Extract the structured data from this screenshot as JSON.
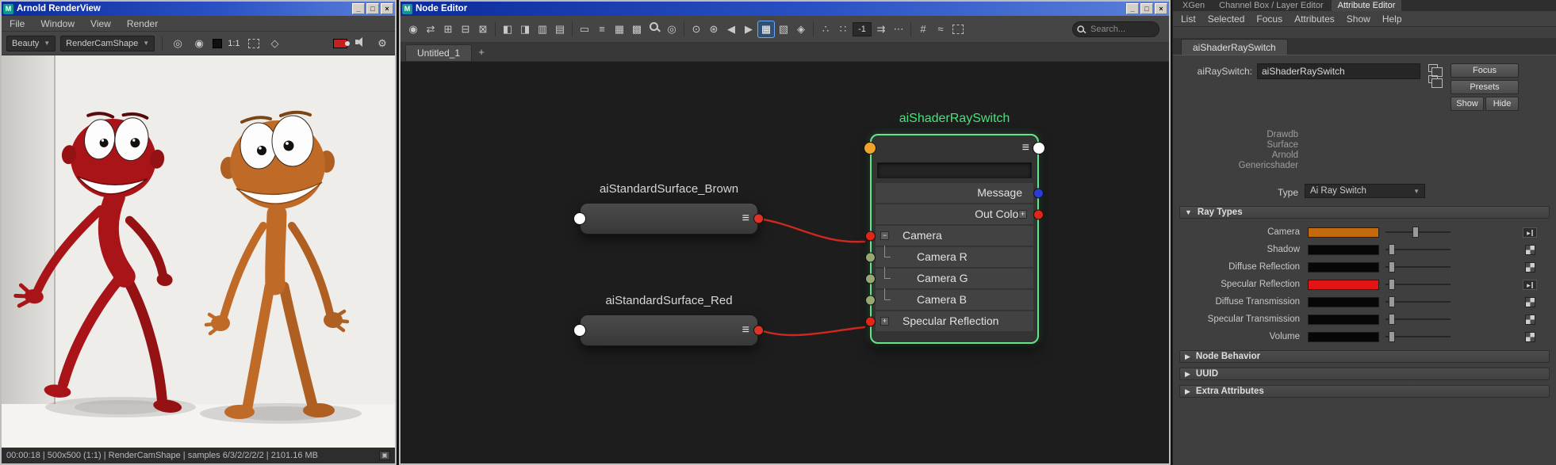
{
  "colors": {
    "wire": "#d0281e",
    "accent_green": "#55e07e"
  },
  "window_controls": [
    {
      "name": "minimize-button",
      "glyph": "_"
    },
    {
      "name": "maximize-button",
      "glyph": "□"
    },
    {
      "name": "close-button",
      "glyph": "×"
    }
  ],
  "maya_icon_text": "M",
  "render_view": {
    "window_title": "Arnold RenderView",
    "menus": [
      "File",
      "Window",
      "View",
      "Render"
    ],
    "toolbar": {
      "aov": "Beauty",
      "camera": "RenderCamShape",
      "icons": [
        {
          "n": "snapshot-target-icon",
          "g": "◎"
        },
        {
          "n": "rgb-channels-icon",
          "g": "◉"
        },
        {
          "n": "background-swatch",
          "t": "swatch-dark"
        },
        {
          "n": "zoom-ratio-label",
          "g": "1:1",
          "t": "label"
        },
        {
          "n": "crop-region-icon",
          "t": "dash"
        },
        {
          "n": "isolate-selected-icon",
          "g": "◇"
        },
        {
          "n": "spacer",
          "t": "spacer"
        },
        {
          "n": "foreground-color-swatch",
          "t": "swatch-red"
        },
        {
          "n": "audio-icon",
          "t": "speaker"
        },
        {
          "n": "render-settings-gear-icon",
          "g": "⚙"
        }
      ]
    },
    "status": "00:00:18 | 500x500 (1:1) | RenderCamShape  | samples 6/3/2/2/2/2 | 2101.16 MB"
  },
  "node_editor": {
    "window_title": "Node Editor",
    "tab": "Untitled_1",
    "new_tab": "+",
    "precision": "-1",
    "search_placeholder": "Search...",
    "toolbar_icons": [
      {
        "n": "pin-panel-icon",
        "g": "◉"
      },
      {
        "n": "sync-graph-icon",
        "g": "⇄"
      },
      {
        "n": "add-to-graph-icon",
        "g": "⊞"
      },
      {
        "n": "remove-from-graph-icon",
        "g": "⊟"
      },
      {
        "n": "clear-graph-icon",
        "g": "⊠"
      },
      {
        "t": "sep"
      },
      {
        "n": "show-input-connections-icon",
        "g": "◧"
      },
      {
        "n": "show-output-connections-icon",
        "g": "◨"
      },
      {
        "n": "show-all-connections-icon",
        "g": "▥"
      },
      {
        "n": "layout-graph-icon",
        "g": "▤"
      },
      {
        "t": "sep"
      },
      {
        "n": "display-simple-mode-icon",
        "g": "▭"
      },
      {
        "n": "display-connected-mode-icon",
        "g": "≡"
      },
      {
        "n": "display-full-mode-icon",
        "g": "▦"
      },
      {
        "n": "display-custom-mode-icon",
        "g": "▩"
      },
      {
        "n": "search-connections-icon",
        "t": "mag"
      },
      {
        "n": "preview-panel-icon",
        "g": "◎"
      },
      {
        "t": "sep"
      },
      {
        "n": "pin-selected-icon",
        "g": "⊙"
      },
      {
        "n": "unpin-all-icon",
        "g": "⊛"
      },
      {
        "n": "traverse-upstream-icon",
        "g": "◀"
      },
      {
        "n": "traverse-downstream-icon",
        "g": "▶"
      },
      {
        "n": "grid-snap-icon",
        "g": "▦",
        "active": true
      },
      {
        "n": "swatch-display-icon",
        "g": "▧"
      },
      {
        "n": "sort-nodes-icon",
        "g": "◈"
      },
      {
        "t": "sep"
      },
      {
        "n": "dot-format-icon",
        "g": "∴"
      },
      {
        "n": "dot-grid-icon",
        "g": "∷"
      },
      {
        "n": "precision-field",
        "t": "field"
      },
      {
        "n": "step-connections-icon",
        "g": "⇉"
      },
      {
        "n": "more-options-icon",
        "g": "⋯"
      },
      {
        "t": "sep"
      },
      {
        "n": "grid-toggle-icon",
        "g": "#"
      },
      {
        "n": "connection-style-icon",
        "g": "≈"
      },
      {
        "n": "marquee-zoom-icon",
        "t": "dash"
      }
    ],
    "port_colors": {
      "surface_in": "#ffffff",
      "surface_out": "#e03224",
      "header_in": "#f0a32a",
      "header_out": "#ffffff"
    },
    "nodes": {
      "brown": {
        "title": "aiStandardSurface_Brown"
      },
      "red": {
        "title": "aiStandardSurface_Red"
      },
      "switch": {
        "title": "aiShaderRaySwitch",
        "rows": [
          {
            "label": "Message",
            "align": "right",
            "dot": "#2b3bd4",
            "dot_side": "right"
          },
          {
            "label": "Out Color",
            "align": "right",
            "dot": "#e02617",
            "dot_side": "right",
            "toggle": "+",
            "toggle_side": "right"
          },
          {
            "label": "Camera",
            "align": "left",
            "dot": "#e02617",
            "dot_side": "left",
            "toggle": "−",
            "toggle_side": "left"
          },
          {
            "label": "Camera R",
            "align": "left",
            "dot": "#97a876",
            "dot_side": "left",
            "indent": true
          },
          {
            "label": "Camera G",
            "align": "left",
            "dot": "#97a876",
            "dot_side": "left",
            "indent": true
          },
          {
            "label": "Camera B",
            "align": "left",
            "dot": "#97a876",
            "dot_side": "left",
            "indent": true
          },
          {
            "label": "Specular Reflection",
            "align": "left",
            "dot": "#e02617",
            "dot_side": "left",
            "toggle": "+",
            "toggle_side": "left"
          }
        ]
      }
    }
  },
  "attribute_editor": {
    "panel_tabs": [
      "XGen",
      "Channel Box / Layer Editor",
      "Attribute Editor"
    ],
    "active_panel_tab": "Attribute Editor",
    "menus": [
      "List",
      "Selected",
      "Focus",
      "Attributes",
      "Show",
      "Help"
    ],
    "node_tab": "aiShaderRaySwitch",
    "name_label": "aiRaySwitch:",
    "name_value": "aiShaderRaySwitch",
    "buttons": {
      "focus": "Focus",
      "presets": "Presets",
      "show": "Show",
      "hide": "Hide"
    },
    "sample_lines": [
      "Drawdb",
      "Surface",
      "Arnold",
      "Genericshader"
    ],
    "type_label": "Type",
    "type_value": "Ai Ray Switch",
    "ray_types_header": "Ray Types",
    "ray_rows": [
      {
        "label": "Camera",
        "color": "#c46a0e",
        "value": 0.46,
        "connected": true
      },
      {
        "label": "Shadow",
        "color": "#070707",
        "value": 0.05,
        "connected": false
      },
      {
        "label": "Diffuse Reflection",
        "color": "#070707",
        "value": 0.05,
        "connected": false
      },
      {
        "label": "Specular Reflection",
        "color": "#e21414",
        "value": 0.05,
        "connected": true
      },
      {
        "label": "Diffuse Transmission",
        "color": "#070707",
        "value": 0.05,
        "connected": false
      },
      {
        "label": "Specular Transmission",
        "color": "#070707",
        "value": 0.05,
        "connected": false
      },
      {
        "label": "Volume",
        "color": "#070707",
        "value": 0.05,
        "connected": false
      }
    ],
    "collapsed_sections": [
      "Node Behavior",
      "UUID",
      "Extra Attributes"
    ]
  }
}
